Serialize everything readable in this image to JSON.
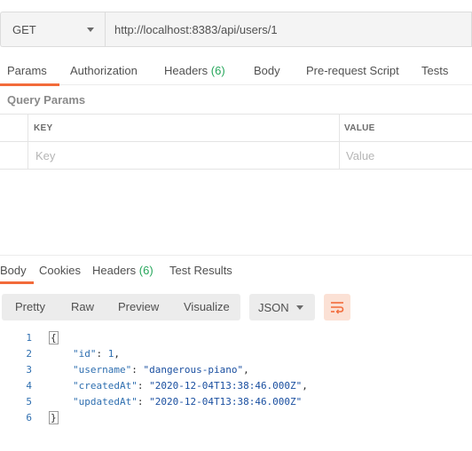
{
  "request": {
    "method": "GET",
    "url": "http://localhost:8383/api/users/1"
  },
  "request_tabs": [
    {
      "label": "Params"
    },
    {
      "label": "Authorization"
    },
    {
      "label": "Headers",
      "count": "(6)"
    },
    {
      "label": "Body"
    },
    {
      "label": "Pre-request Script"
    },
    {
      "label": "Tests"
    }
  ],
  "query_params": {
    "section_label": "Query Params",
    "key_header": "KEY",
    "value_header": "VALUE",
    "key_placeholder": "Key",
    "value_placeholder": "Value"
  },
  "response_tabs": [
    {
      "label": "Body"
    },
    {
      "label": "Cookies"
    },
    {
      "label": "Headers",
      "count": "(6)"
    },
    {
      "label": "Test Results"
    }
  ],
  "view_modes": [
    "Pretty",
    "Raw",
    "Preview",
    "Visualize"
  ],
  "format": "JSON",
  "wrap_icon": "wrap-lines-icon",
  "code_lines": [
    {
      "num": "1",
      "text": "{"
    },
    {
      "num": "2",
      "key": "\"id\"",
      "value": "1",
      "type": "num",
      "trail": ","
    },
    {
      "num": "3",
      "key": "\"username\"",
      "value": "\"dangerous-piano\"",
      "type": "str",
      "trail": ","
    },
    {
      "num": "4",
      "key": "\"createdAt\"",
      "value": "\"2020-12-04T13:38:46.000Z\"",
      "type": "str",
      "trail": ","
    },
    {
      "num": "5",
      "key": "\"updatedAt\"",
      "value": "\"2020-12-04T13:38:46.000Z\"",
      "type": "str",
      "trail": ""
    },
    {
      "num": "6",
      "text": "}"
    }
  ],
  "colors": {
    "accent": "#f26b3a",
    "count_green": "#26a65b",
    "code_blue": "#2f6fb0"
  }
}
